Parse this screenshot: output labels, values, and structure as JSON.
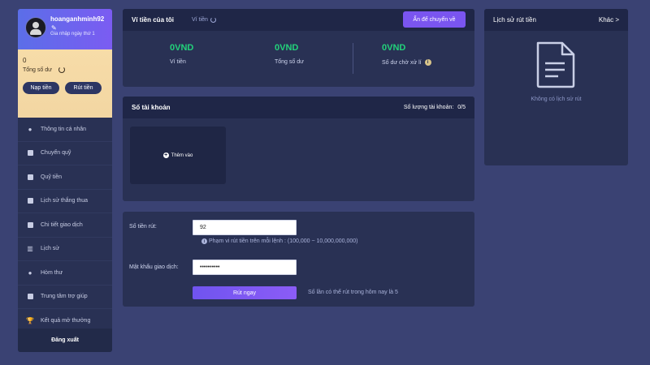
{
  "profile": {
    "username": "hoanganhminh92",
    "edit_icon": "pencil-icon",
    "level": "Gia nhập ngày thứ 1",
    "balance": "0",
    "balance_label": "Tổng số dư",
    "deposit_label": "Nạp tiền",
    "withdraw_label": "Rút tiền"
  },
  "sidebar": {
    "items": [
      {
        "label": "Thông tin cá nhân",
        "icon": "user-icon"
      },
      {
        "label": "Chuyển quỹ",
        "icon": "wallet-icon"
      },
      {
        "label": "Quỹ tiền",
        "icon": "fund-icon"
      },
      {
        "label": "Lịch sử thắng thua",
        "icon": "history-icon"
      },
      {
        "label": "Chi tiết giao dịch",
        "icon": "transactions-icon"
      },
      {
        "label": "Lịch sử",
        "icon": "chart-icon"
      },
      {
        "label": "Hòm thư",
        "icon": "mail-icon"
      },
      {
        "label": "Trung tâm trợ giúp",
        "icon": "help-icon"
      },
      {
        "label": "Kết quả mở thưởng",
        "icon": "trophy-icon"
      }
    ],
    "logout_label": "Đăng xuất"
  },
  "wallet": {
    "title": "Ví tiền của tôi",
    "tab_wallet": "Ví tiền",
    "hide_button": "Ẩn để chuyển về",
    "stats": [
      {
        "value": "0VND",
        "label": "Ví tiền"
      },
      {
        "value": "0VND",
        "label": "Tổng số dư"
      },
      {
        "value": "0VND",
        "label": "Số dư chờ xử lí"
      }
    ]
  },
  "accounts": {
    "title": "Số tài khoản",
    "count_label": "Số lượng tài khoản:",
    "count_value": "0/5",
    "add_label": "Thêm vào"
  },
  "withdraw": {
    "amount_label": "Số tiền rút:",
    "amount_value": "92",
    "range_note": "Phạm vi rút tiền trên mỗi lệnh : (100,000 ~ 10,000,000,000)",
    "password_label": "Mật khẩu giao dịch:",
    "password_value": "••••••••••",
    "submit_label": "Rút ngay",
    "times_note": "Số lần có thể rút trong hôm nay là 5"
  },
  "history": {
    "title": "Lịch sử rút tiền",
    "more_label": "Khác >",
    "empty_label": "Không có lịch sử rút",
    "empty_icon": "document-icon"
  },
  "colors": {
    "background": "#3a4273",
    "panel": "#293154",
    "panel_header": "#1f2647",
    "accent": "#7a55f0",
    "money": "#22d27a",
    "balance_card": "#f7dca8"
  }
}
